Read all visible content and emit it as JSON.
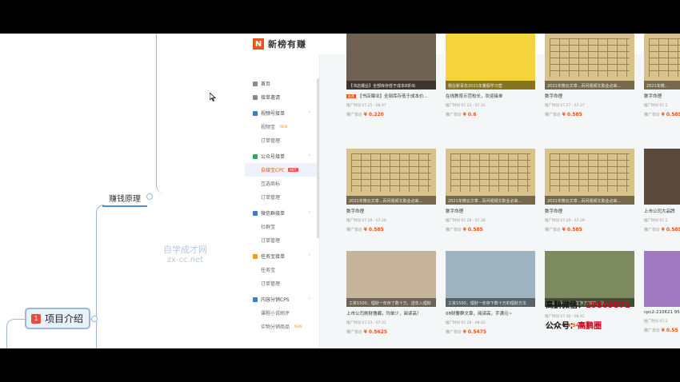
{
  "mindmap": {
    "node_label": "赚钱原理",
    "root_badge": "1",
    "root_label": "项目介绍"
  },
  "watermark": {
    "line1": "自学成才网",
    "line2": "zx-cc.net"
  },
  "app": {
    "logo_mark": "N",
    "logo_text": "新榜有赚"
  },
  "sidebar": {
    "items": [
      {
        "label": "首页",
        "type": "top"
      },
      {
        "label": "接单邀请",
        "type": "top"
      },
      {
        "label": "视频号接单",
        "type": "group"
      },
      {
        "label": "视频宝",
        "type": "sub",
        "tag": "NEW"
      },
      {
        "label": "订单管理",
        "type": "sub"
      },
      {
        "label": "公众号接单",
        "type": "group"
      },
      {
        "label": "自媒宝CPC",
        "type": "sub",
        "tag": "HOT"
      },
      {
        "label": "互选商标",
        "type": "sub"
      },
      {
        "label": "订单管理",
        "type": "sub"
      },
      {
        "label": "微信群接单",
        "type": "group"
      },
      {
        "label": "社群宝",
        "type": "sub"
      },
      {
        "label": "订单管理",
        "type": "sub"
      },
      {
        "label": "任务宝接单",
        "type": "group"
      },
      {
        "label": "任务宝",
        "type": "sub"
      },
      {
        "label": "订单管理",
        "type": "sub"
      },
      {
        "label": "内容分销CPS",
        "type": "group"
      },
      {
        "label": "课程小说刷评",
        "type": "sub"
      },
      {
        "label": "实物分销商品",
        "type": "sub",
        "tag": "NEW"
      }
    ]
  },
  "cards": [
    {
      "caption": "【书店爆业】全部库存低于成本8折出",
      "title": "【书店爆业】全部库存低于成本价...",
      "hot": "推荐",
      "date": "推广时间 07.25 - 08.07",
      "price_label": "推广单价",
      "price": "¥ 0.220",
      "thumb": "t-books"
    },
    {
      "caption": "我在新青年2021年暑假学习营",
      "title": "在线教育示范校长，欢迎接单",
      "hot": "",
      "date": "推广时间 07.23 - 07.31",
      "price_label": "推广单价",
      "price": "¥ 0.6",
      "thumb": "t-yellow"
    },
    {
      "caption": "2021年微云文章...百问视频文职业必来...",
      "title": "数字命理",
      "hot": "",
      "date": "推广时间 07.27 - 07.27",
      "price_label": "推广单价",
      "price": "¥ 0.585",
      "thumb": "t-board"
    },
    {
      "caption": "2021年微...",
      "title": "数字命理",
      "hot": "",
      "date": "推广时间 07.2",
      "price_label": "推广单价",
      "price": "¥ 0.585",
      "thumb": "t-board"
    },
    {
      "caption": "2021年微云文章...百问视频文职业必来...",
      "title": "数字命理",
      "hot": "",
      "date": "推广时间 07.28 - 07.28",
      "price_label": "推广单价",
      "price": "¥ 0.585",
      "thumb": "t-board"
    },
    {
      "caption": "2021年微云文章...百问视频文职业必来...",
      "title": "数字命理",
      "hot": "",
      "date": "推广时间 07.28 - 07.28",
      "price_label": "推广单价",
      "price": "¥ 0.585",
      "thumb": "t-board"
    },
    {
      "caption": "2021年微云文章...百问视频文职业必来...",
      "title": "数字命理",
      "hot": "",
      "date": "推广时间 07.29 - 07.29",
      "price_label": "推广单价",
      "price": "¥ 0.585",
      "thumb": "t-board"
    },
    {
      "caption": "",
      "title": "上市公司大品牌",
      "hot": "",
      "date": "推广时间 07.2",
      "price_label": "推广单价",
      "price": "¥ 0.585",
      "thumb": "t-dark"
    },
    {
      "caption": "工资1500，理财一年存了数十万，送年入理财",
      "title": "上市公司刷财撸薅，均单少，阅读高！",
      "hot": "",
      "date": "推广时间 07.13 - 07.31",
      "price_label": "推广单价",
      "price": "¥ 0.5625",
      "thumb": "t-money"
    },
    {
      "caption": "工资1500，理财一年存下数十万的理财方法",
      "title": "08财要群文章，阅读高，手满元~",
      "hot": "",
      "date": "推广时间 07.28 - 08.02",
      "price_label": "推广单价",
      "price": "¥ 0.5475",
      "thumb": "t-sea"
    },
    {
      "caption": "小红书种草，一年存了20万，让...",
      "title": "",
      "hot": "",
      "date": "推广时间 07.30 - 08.02",
      "price_label": "推广单价",
      "price": "¥ 0.5475",
      "thumb": "t-tree"
    },
    {
      "caption": "",
      "title": "cpc2-210621 95...",
      "hot": "",
      "date": "推广时间 07.2",
      "price_label": "推广单价",
      "price": "¥ 0.55",
      "thumb": "t-purple"
    }
  ],
  "overlay": {
    "wechat_label": "高鹏微信：",
    "wechat_value": "19809871",
    "gzh_label": "公众号：",
    "gzh_value": "高鹏圈"
  }
}
